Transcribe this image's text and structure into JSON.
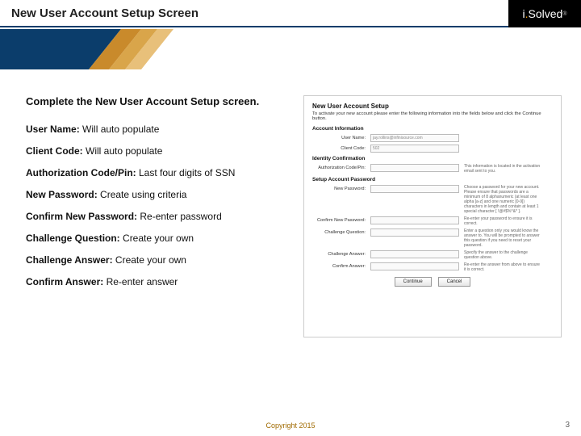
{
  "header": {
    "title": "New User Account Setup Screen"
  },
  "logo": {
    "i": "i",
    "dot": ".",
    "text": "Solved",
    "reg": "®"
  },
  "intro": "Complete the New User Account Setup screen.",
  "items": [
    {
      "k": "User Name:",
      "v": " Will auto populate"
    },
    {
      "k": "Client Code:",
      "v": " Will auto populate"
    },
    {
      "k": "Authorization Code/Pin:",
      "v": "  Last four digits of SSN"
    },
    {
      "k": "New Password:",
      "v": "  Create using criteria"
    },
    {
      "k": "Confirm New Password:",
      "v": " Re-enter password"
    },
    {
      "k": "Challenge Question:",
      "v": "  Create your own"
    },
    {
      "k": "Challenge Answer:",
      "v": "  Create your own"
    },
    {
      "k": "Confirm Answer:",
      "v": " Re-enter answer"
    }
  ],
  "form": {
    "title": "New User Account Setup",
    "subtitle": "To activate your new account please enter the following information into the fields below and click the Continue button.",
    "sections": {
      "account": "Account Information",
      "identity": "Identity Confirmation",
      "password": "Setup Account Password"
    },
    "fields": {
      "username": {
        "label": "User Name:",
        "value": "jay.rollins@infinisource.com"
      },
      "clientcode": {
        "label": "Client Code:",
        "value": "502"
      },
      "authcode": {
        "label": "Authorization Code/Pin:",
        "help": "This information is located in the activation email sent to you."
      },
      "newpass": {
        "label": "New Password:",
        "help": "Choose a password for your new account. Please ensure that passwords are a minimum of 8 alphanumeric (at least one alpha [a-z] and one numeric [0-9]) characters in length and contain at least 1 special character [ !@#$%^&* ]."
      },
      "confirmpass": {
        "label": "Confirm New Password:",
        "help": "Re-enter your password to ensure it is correct."
      },
      "question": {
        "label": "Challenge Question:",
        "help": "Enter a question only you would know the answer to. You will be prompted to answer this question if you need to reset your password."
      },
      "answer": {
        "label": "Challenge Answer:",
        "help": "Specify the answer to the challenge question above."
      },
      "confirmanswer": {
        "label": "Confirm Answer:",
        "help": "Re-enter the answer from above to ensure it is correct."
      }
    },
    "buttons": {
      "continue": "Continue",
      "cancel": "Cancel"
    }
  },
  "footer": {
    "copyright": "Copyright 2015",
    "page": "3"
  }
}
